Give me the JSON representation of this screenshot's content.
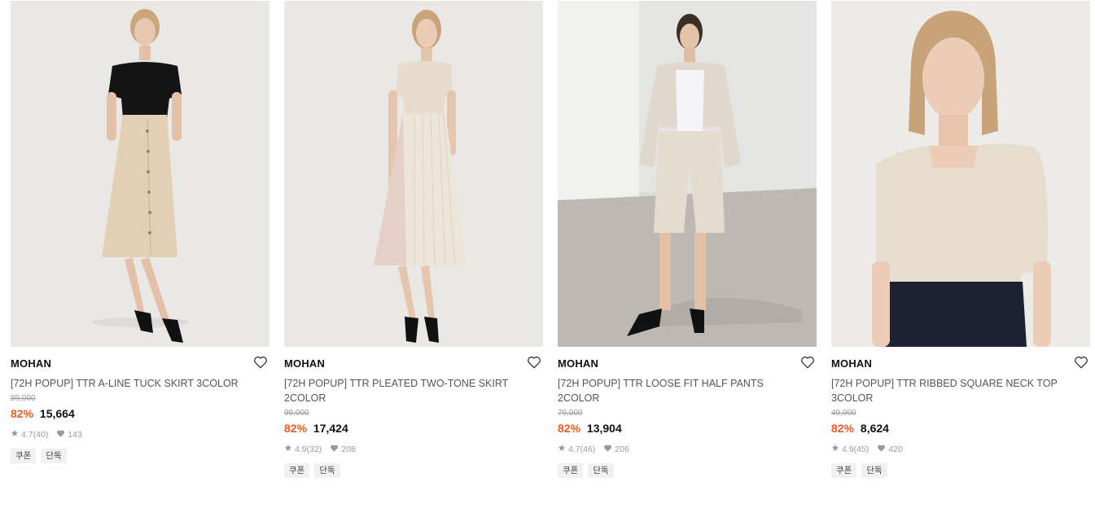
{
  "products": [
    {
      "brand": "MOHAN",
      "name": "[72H POPUP] TTR A-LINE TUCK SKIRT 3COLOR",
      "original_price": "89,000",
      "discount": "82%",
      "price": "15,664",
      "rating": "4.7",
      "reviews": "(40)",
      "likes": "143",
      "tags": [
        "쿠폰",
        "단독"
      ],
      "image_alt": "model in black top and beige button skirt"
    },
    {
      "brand": "MOHAN",
      "name": "[72H POPUP] TTR PLEATED TWO-TONE SKIRT 2COLOR",
      "original_price": "99,000",
      "discount": "82%",
      "price": "17,424",
      "rating": "4.9",
      "reviews": "(32)",
      "likes": "208",
      "tags": [
        "쿠폰",
        "단독"
      ],
      "image_alt": "model in cream top and pleated skirt"
    },
    {
      "brand": "MOHAN",
      "name": "[72H POPUP] TTR LOOSE FIT HALF PANTS 2COLOR",
      "original_price": "79,000",
      "discount": "82%",
      "price": "13,904",
      "rating": "4.7",
      "reviews": "(46)",
      "likes": "206",
      "tags": [
        "쿠폰",
        "단독"
      ],
      "image_alt": "model in beige blazer and half pants outdoors"
    },
    {
      "brand": "MOHAN",
      "name": "[72H POPUP] TTR RIBBED SQUARE NECK TOP 3COLOR",
      "original_price": "49,000",
      "discount": "82%",
      "price": "8,624",
      "rating": "4.9",
      "reviews": "(45)",
      "likes": "420",
      "tags": [
        "쿠폰",
        "단독"
      ],
      "image_alt": "close-up of model in square neck top"
    }
  ],
  "colors": {
    "discount": "#ef5a1f",
    "text": "#222222",
    "muted": "#999999",
    "tag_bg": "#f1f1f1"
  }
}
